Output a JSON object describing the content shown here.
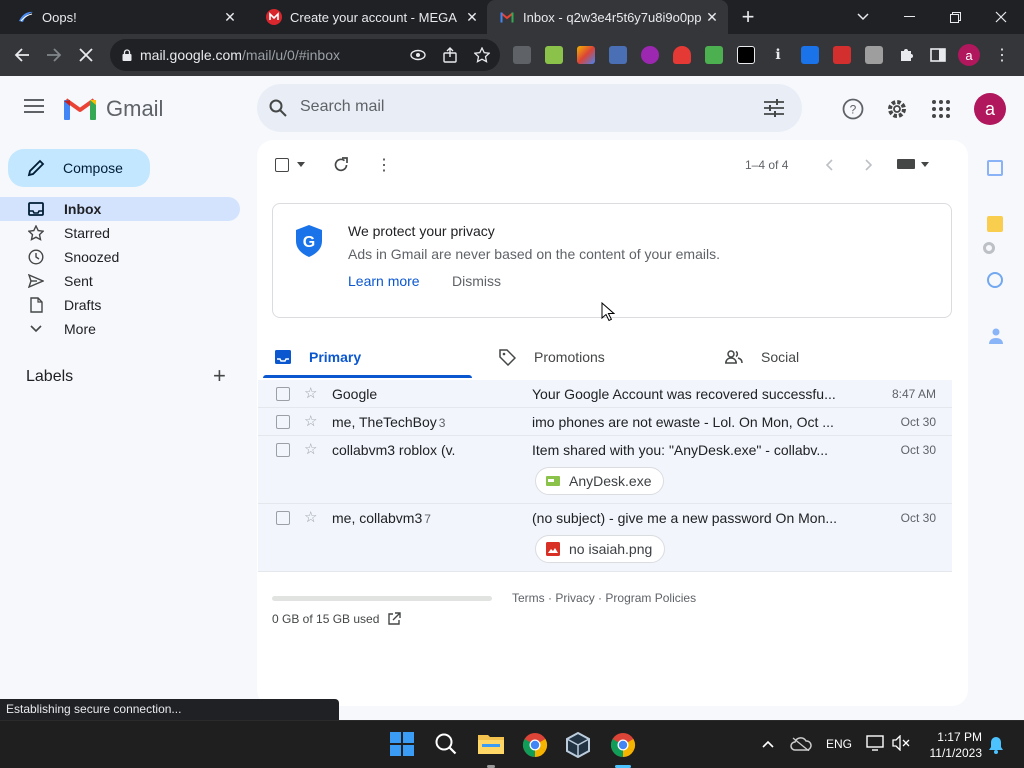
{
  "browser": {
    "tabs": [
      {
        "title": "Oops!",
        "favicon": "blue-swoosh-icon"
      },
      {
        "title": "Create your account - MEGA",
        "favicon": "mega-icon"
      },
      {
        "title": "Inbox - q2w3e4r5t6y7u8i9o0pp",
        "favicon": "gmail-icon"
      }
    ],
    "new_tab": "+",
    "url_host": "mail.google.com",
    "url_path": "/mail/u/0/#inbox",
    "profile_letter": "a",
    "status_text": "Establishing secure connection..."
  },
  "gmail": {
    "logo_text": "Gmail",
    "search_placeholder": "Search mail",
    "avatar_letter": "a",
    "compose_label": "Compose",
    "nav": [
      {
        "label": "Inbox",
        "icon": "inbox-icon"
      },
      {
        "label": "Starred",
        "icon": "star-icon"
      },
      {
        "label": "Snoozed",
        "icon": "clock-icon"
      },
      {
        "label": "Sent",
        "icon": "send-icon"
      },
      {
        "label": "Drafts",
        "icon": "draft-icon"
      },
      {
        "label": "More",
        "icon": "chevron-down-icon"
      }
    ],
    "labels_heading": "Labels",
    "labels_add": "+",
    "pagination": "1–4 of 4",
    "privacy": {
      "title": "We protect your privacy",
      "body": "Ads in Gmail are never based on the content of your emails.",
      "learn_more": "Learn more",
      "dismiss": "Dismiss"
    },
    "tabs": [
      {
        "label": "Primary"
      },
      {
        "label": "Promotions"
      },
      {
        "label": "Social"
      }
    ],
    "emails": [
      {
        "sender": "Google",
        "count": "",
        "subject": "Your Google Account was recovered successfu...",
        "date": "8:47 AM",
        "attachment": ""
      },
      {
        "sender": "me, TheTechBoy",
        "count": "3",
        "subject": "imo phones are not ewaste - Lol. On Mon, Oct ...",
        "date": "Oct 30",
        "attachment": ""
      },
      {
        "sender": "collabvm3 roblox (v.",
        "count": "",
        "subject": "Item shared with you: \"AnyDesk.exe\" - collabv...",
        "date": "Oct 30",
        "attachment": "AnyDesk.exe"
      },
      {
        "sender": "me, collabvm3",
        "count": "7",
        "subject": "(no subject) - give me a new password On Mon...",
        "date": "Oct 30",
        "attachment": "no isaiah.png"
      }
    ],
    "storage": "0 GB of 15 GB used",
    "footer": {
      "terms": "Terms",
      "privacy": "Privacy",
      "policies": "Program Policies",
      "sep": "·"
    }
  },
  "taskbar": {
    "lang": "ENG",
    "time": "1:17 PM",
    "date": "11/1/2023"
  },
  "colors": {
    "accent": "#0b57d0",
    "selected_nav": "#d3e3fd",
    "compose_bg": "#c2e7ff",
    "avatar": "#b0175c"
  }
}
